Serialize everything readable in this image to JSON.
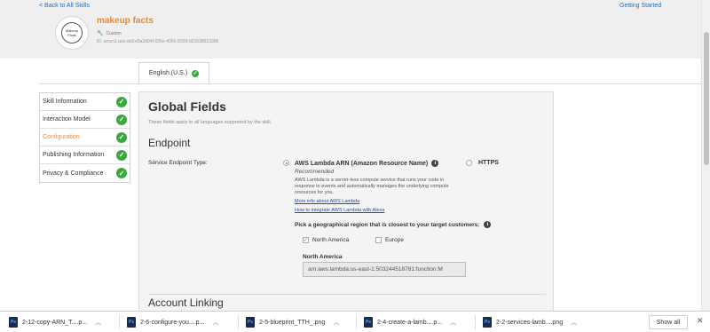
{
  "header": {
    "back_link": "< Back to All Skills",
    "getting_started": "Getting Started",
    "skill_name": "makeup facts",
    "skill_type": "Custom",
    "skill_id": "ID: amzn1.ask.skill.e5a3d94f-026e-4066-8303-d21638513396",
    "icon_text": "Makeup Facts"
  },
  "language_tab": {
    "label": "English (U.S.)"
  },
  "left_nav": {
    "items": [
      {
        "label": "Skill Information"
      },
      {
        "label": "Interaction Model"
      },
      {
        "label": "Configuration"
      },
      {
        "label": "Publishing Information"
      },
      {
        "label": "Privacy & Compliance"
      }
    ],
    "active_index": 2
  },
  "main": {
    "title": "Global Fields",
    "subtitle": "These fields apply to all languages supported by the skill.",
    "endpoint_title": "Endpoint",
    "service_endpoint_label": "Service Endpoint Type:",
    "lambda_option": "AWS Lambda ARN (Amazon Resource Name)",
    "https_option": "HTTPS",
    "selected_endpoint": "AWS Lambda ARN (Amazon Resource Name)",
    "recommended": "Recommended",
    "lambda_description": "AWS Lambda is a server-less compute service that runs your code in response to events and automatically manages the underlying compute resources for you.",
    "more_info_link": "More info about AWS Lambda",
    "integrate_link": "How to integrate AWS Lambda with Alexa",
    "geo_question": "Pick a geographical region that is closest to your target customers:",
    "region_na": "North America",
    "region_eu": "Europe",
    "region_na_checked": true,
    "region_eu_checked": false,
    "na_heading": "North America",
    "arn_value": "arn:aws:lambda:us-east-1:503244518781:function:M",
    "account_linking": "Account Linking"
  },
  "downloads": {
    "items": [
      {
        "name": "2-12-copy-ARN_T....p..."
      },
      {
        "name": "2-6-configure-you....p..."
      },
      {
        "name": "2-5-blueprint_TTH_.png"
      },
      {
        "name": "2-4-create-a-lamb....p..."
      },
      {
        "name": "2-2-services-lamb....png"
      }
    ],
    "icon_label": "Ps",
    "show_all": "Show all"
  },
  "colors": {
    "accent_orange": "#f0892a",
    "check_green": "#3aa83a",
    "link_blue": "#1f6fbf"
  }
}
